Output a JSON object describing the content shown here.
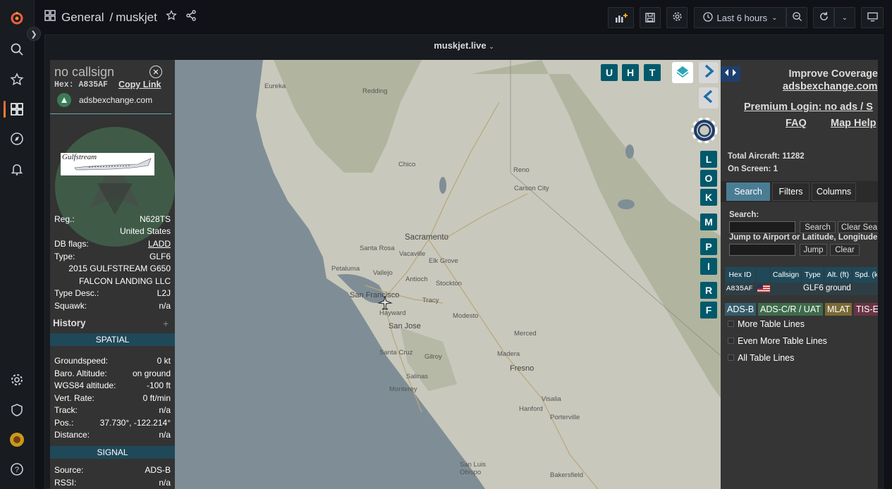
{
  "nav": {
    "items": [
      "logo",
      "search",
      "starred",
      "dashboards",
      "explore",
      "alerting",
      "configuration",
      "server-admin",
      "profile",
      "help"
    ]
  },
  "breadcrumb": {
    "folder": "General",
    "separator": "/",
    "dashboard": "muskjet"
  },
  "toolbar": {
    "time_range": "Last 6 hours"
  },
  "panel": {
    "title": "muskjet.live"
  },
  "aircraft": {
    "callsign": "no callsign",
    "hex_label": "Hex:",
    "hex": "A835AF",
    "copy_link": "Copy Link",
    "source_link": "adsbexchange.com",
    "reg_label": "Reg.:",
    "reg": "N628TS",
    "country": "United States",
    "dbflags_label": "DB flags:",
    "dbflags": "LADD",
    "type_label": "Type:",
    "type": "GLF6",
    "model": "2015 GULFSTREAM G650",
    "owner": "FALCON LANDING LLC",
    "typedesc_label": "Type Desc.:",
    "typedesc": "L2J",
    "squawk_label": "Squawk:",
    "squawk": "n/a",
    "history_label": "History",
    "spatial_label": "SPATIAL",
    "groundspeed_label": "Groundspeed:",
    "groundspeed": "0 kt",
    "baro_label": "Baro. Altitude:",
    "baro": "on ground",
    "wgs_label": "WGS84 altitude:",
    "wgs": "-100 ft",
    "vrate_label": "Vert. Rate:",
    "vrate": "0 ft/min",
    "track_label": "Track:",
    "track": "n/a",
    "pos_label": "Pos.:",
    "pos": "37.730°, -122.214°",
    "distance_label": "Distance:",
    "distance": "n/a",
    "signal_label": "SIGNAL",
    "source_label": "Source:",
    "source": "ADS-B",
    "rssi_label": "RSSI:",
    "rssi": "n/a",
    "image_text": "Gulfstream"
  },
  "map": {
    "buttons_top": [
      "U",
      "H",
      "T"
    ],
    "buttons_side": [
      "L",
      "O",
      "K",
      "M",
      "P",
      "I",
      "R",
      "F"
    ],
    "cities": {
      "eureka": "Eureka",
      "redding": "Redding",
      "chico": "Chico",
      "reno": "Reno",
      "carson": "Carson City",
      "sacramento": "Sacramento",
      "santarosa": "Santa Rosa",
      "vacaville": "Vacaville",
      "elkgrove": "Elk Grove",
      "petaluma": "Petaluma",
      "vallejo": "Vallejo",
      "antioch": "Antioch",
      "stockton": "Stockton",
      "sanfrancisco": "San Francisco",
      "hayward": "Hayward",
      "tracy": "Tracy",
      "sanjose": "San Jose",
      "modesto": "Modesto",
      "merced": "Merced",
      "santacruz": "Santa Cruz",
      "gilroy": "Gilroy",
      "salinas": "Salinas",
      "madera": "Madera",
      "fresno": "Fresno",
      "monterey": "Monterey",
      "visalia": "Visalia",
      "hanford": "Hanford",
      "porterville": "Porterville",
      "sanluis": "San Luis Obispo",
      "bakersfield": "Bakersfield"
    }
  },
  "right": {
    "improve": "Improve Coverage",
    "adsbx": "adsbexchange.com",
    "premium": "Premium Login: no ads / S",
    "faq": "FAQ",
    "maphelp": "Map Help",
    "total_label": "Total Aircraft:",
    "total": "11282",
    "onscreen_label": "On Screen:",
    "onscreen": "1",
    "tabs": [
      "Search",
      "Filters",
      "Columns"
    ],
    "search_label": "Search:",
    "search_btn": "Search",
    "clear_search_btn": "Clear Sea",
    "jump_label": "Jump to Airport or Latitude, Longitude",
    "jump_btn": "Jump",
    "clear_btn": "Clear",
    "columns": [
      "Hex ID",
      "",
      "Callsign",
      "Type",
      "Alt. (ft)",
      "Spd. (k"
    ],
    "row": {
      "hex": "A835AF",
      "type": "GLF6",
      "alt": "ground"
    },
    "legend": [
      "ADS-B",
      "ADS-C/R / UAT",
      "MLAT",
      "TIS-E"
    ],
    "options": [
      "More Table Lines",
      "Even More Table Lines",
      "All Table Lines"
    ]
  },
  "colors": {
    "accent": "#00596b",
    "header": "#1f4959",
    "grafana_orange": "#f55f3e"
  }
}
